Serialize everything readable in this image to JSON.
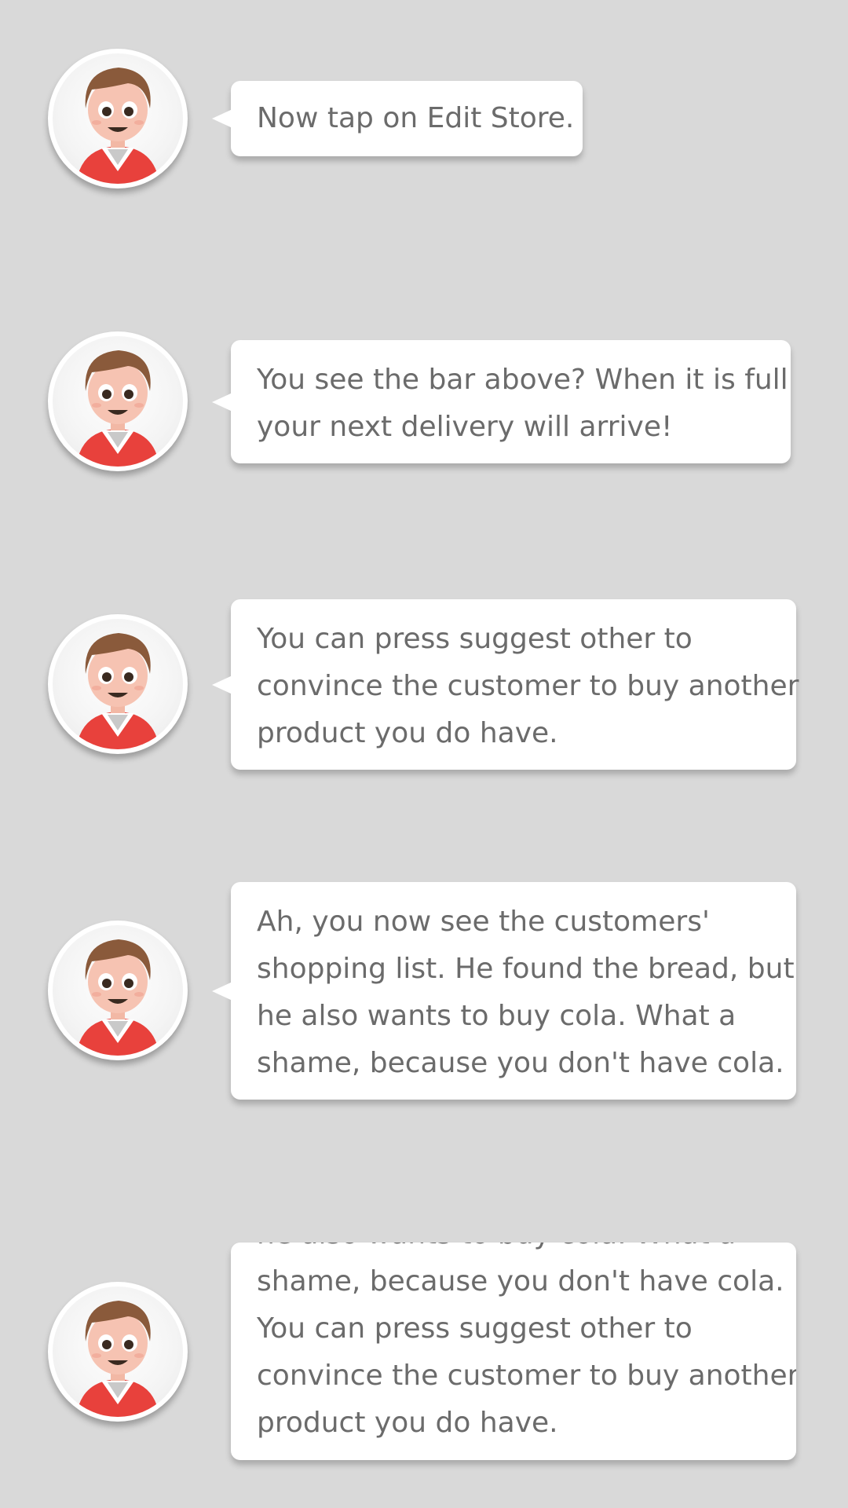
{
  "messages": [
    {
      "lines": [
        "Now tap on Edit Store."
      ]
    },
    {
      "lines": [
        "You see the bar above? When it is full",
        "your next delivery will arrive!"
      ]
    },
    {
      "lines": [
        "You can press suggest other to",
        "convince the customer to buy another",
        "product you do have."
      ]
    },
    {
      "lines": [
        "Ah, you now see the customers'",
        "shopping list. He found the bread, but",
        "he also wants to buy cola. What a",
        "shame, because you don't have cola."
      ]
    },
    {
      "lines": [
        "he also wants to buy cola. What a",
        "shame, because you don't have cola.",
        "You can press suggest other to",
        "convince the customer to buy another",
        "product you do have."
      ]
    }
  ],
  "avatar": {
    "icon": "shopkeeper-avatar-icon",
    "shirt_color": "#e8413c",
    "hair_color": "#8a5a3b"
  }
}
